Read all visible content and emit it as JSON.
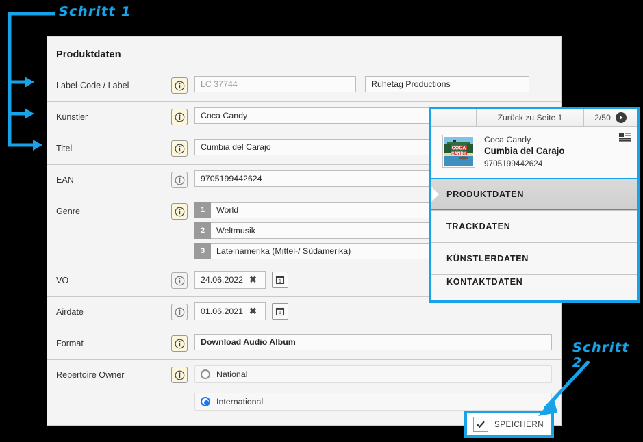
{
  "form": {
    "title": "Produktdaten",
    "rows": [
      {
        "label": "Label-Code / Label",
        "value": "LC 37744",
        "second_value": "Ruhetag Productions",
        "info_highlight": true
      },
      {
        "label": "Künstler",
        "value": "Coca Candy",
        "info_highlight": true
      },
      {
        "label": "Titel",
        "value": "Cumbia del Carajo",
        "info_highlight": true
      },
      {
        "label": "EAN",
        "value": "9705199442624",
        "info_highlight": false
      },
      {
        "label": "Genre",
        "info_highlight": true
      },
      {
        "label": "VÖ",
        "value": "24.06.2022",
        "info_highlight": false
      },
      {
        "label": "Airdate",
        "value": "01.06.2021",
        "info_highlight": false
      },
      {
        "label": "Format",
        "value": "Download Audio Album",
        "info_highlight": true
      },
      {
        "label": "Repertoire Owner",
        "info_highlight": true
      }
    ],
    "genre": [
      {
        "num": "1",
        "value": "World"
      },
      {
        "num": "2",
        "value": "Weltmusik"
      },
      {
        "num": "3",
        "value": "Lateinamerika (Mittel-/ Südamerika)"
      }
    ],
    "repertoire_options": [
      {
        "label": "National",
        "selected": false
      },
      {
        "label": "International",
        "selected": true
      }
    ],
    "clear_glyph": "✖"
  },
  "save_button": {
    "label": "SPEICHERN",
    "check_glyph": "✔"
  },
  "side_panel": {
    "back_label": "Zurück zu Seite 1",
    "page_counter": "2/50",
    "artist": "Coca Candy",
    "title": "Cumbia del Carajo",
    "ean": "9705199442624",
    "items": [
      {
        "label": "PRODUKTDATEN",
        "active": true
      },
      {
        "label": "TRACKDATEN",
        "active": false
      },
      {
        "label": "KÜNSTLERDATEN",
        "active": false
      },
      {
        "label": "KONTAKTDATEN",
        "active": false
      }
    ]
  },
  "annotations": {
    "step1": "Schritt 1",
    "step2": "Schritt 2",
    "accent_color": "#18a2e8"
  }
}
